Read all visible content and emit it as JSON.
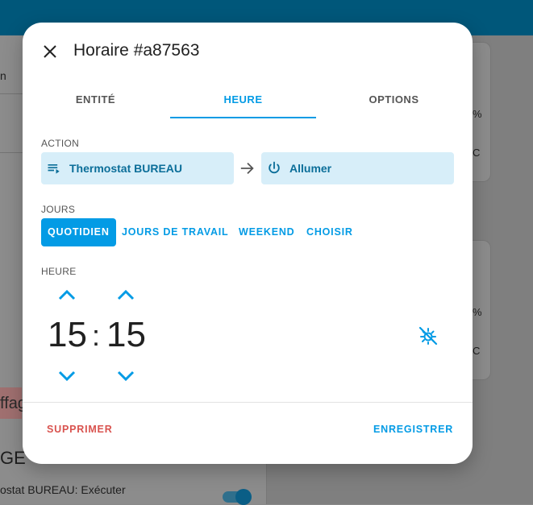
{
  "background": {
    "left_snippets": {
      "top_char": "n",
      "red_label": "ffag",
      "heading": "GE",
      "item": "ostat BUREAU: Exécuter"
    },
    "right_snippets": {
      "pct_1": "%",
      "unit_1": "C",
      "pct_2": "%",
      "unit_2": "C"
    }
  },
  "dialog": {
    "title": "Horaire #a87563",
    "close_icon": "close-icon",
    "tabs": [
      {
        "label": "ENTITÉ",
        "active": false
      },
      {
        "label": "HEURE",
        "active": true
      },
      {
        "label": "OPTIONS",
        "active": false
      }
    ],
    "action": {
      "label": "ACTION",
      "entity": {
        "icon": "playlist-play-icon",
        "text": "Thermostat BUREAU"
      },
      "arrow_icon": "arrow-right-icon",
      "service": {
        "icon": "power-icon",
        "text": "Allumer"
      }
    },
    "days": {
      "label": "JOURS",
      "options": [
        {
          "label": "QUOTIDIEN",
          "active": true
        },
        {
          "label": "JOURS DE TRAVAIL",
          "active": false
        },
        {
          "label": "WEEKEND",
          "active": false
        },
        {
          "label": "CHOISIR",
          "active": false
        }
      ]
    },
    "time": {
      "label": "HEURE",
      "hours": "15",
      "separator": ":",
      "minutes": "15",
      "sun_icon": "weather-sunset-off-icon"
    },
    "footer": {
      "delete_label": "SUPPRIMER",
      "save_label": "ENREGISTRER"
    }
  },
  "colors": {
    "accent": "#039be5",
    "danger": "#d9534f",
    "chip_bg": "#d7eef9",
    "chip_text": "#0b6e99",
    "header": "#00577a"
  }
}
